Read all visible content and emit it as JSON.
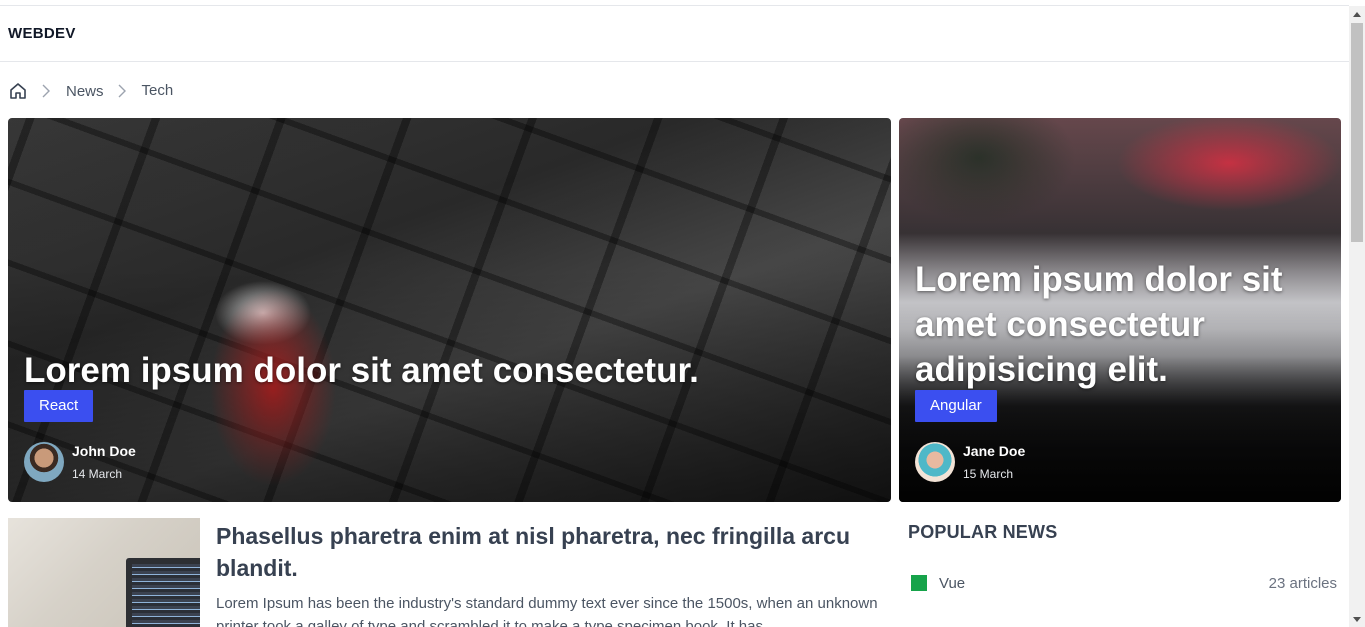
{
  "header": {
    "brand": "WEBDEV"
  },
  "breadcrumb": {
    "items": [
      "News",
      "Tech"
    ]
  },
  "featured": [
    {
      "title": "Lorem ipsum dolor sit amet consectetur.",
      "tag": "React",
      "author": "John Doe",
      "date": "14 March",
      "image": "keyboard-caution-cone"
    },
    {
      "title": "Lorem ipsum dolor sit amet consectetur adipisicing elit.",
      "tag": "Angular",
      "author": "Jane Doe",
      "date": "15 March",
      "image": "desk-monitors-code"
    }
  ],
  "article": {
    "title": "Phasellus pharetra enim at nisl pharetra, nec fringilla arcu blandit.",
    "excerpt": "Lorem Ipsum has been the industry's standard dummy text ever since the 1500s, when an unknown printer took a galley of type and scrambled it to make a type specimen book. It has"
  },
  "popular": {
    "title": "POPULAR NEWS",
    "items": [
      {
        "label": "Vue",
        "count": "23 articles",
        "color": "#16a34a"
      }
    ]
  },
  "colors": {
    "tag": "#3b4ff0",
    "accent_green": "#16a34a"
  }
}
